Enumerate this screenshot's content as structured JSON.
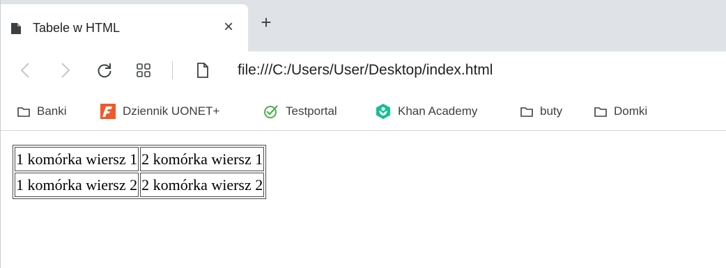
{
  "tab": {
    "title": "Tabele w HTML",
    "close_symbol": "×",
    "new_tab_symbol": "+"
  },
  "toolbar": {
    "url": "file:///C:/Users/User/Desktop/index.html"
  },
  "bookmarks": [
    {
      "label": "Banki",
      "icon": "folder-icon"
    },
    {
      "label": "Dziennik UONET+",
      "icon": "uonet-icon"
    },
    {
      "label": "Testportal",
      "icon": "testportal-icon"
    },
    {
      "label": "Khan Academy",
      "icon": "khan-academy-icon"
    },
    {
      "label": "buty",
      "icon": "folder-icon"
    },
    {
      "label": "Domki",
      "icon": "folder-icon"
    }
  ],
  "table": {
    "rows": [
      [
        "1 komórka wiersz 1",
        "2 komórka wiersz 1"
      ],
      [
        "1 komórka wiersz 2",
        "2 komórka wiersz 2"
      ]
    ]
  },
  "colors": {
    "tabstrip": "#dfe3e8",
    "uonet_orange": "#f05a28",
    "testportal_green": "#4caf50",
    "khan_green": "#14bf96"
  }
}
